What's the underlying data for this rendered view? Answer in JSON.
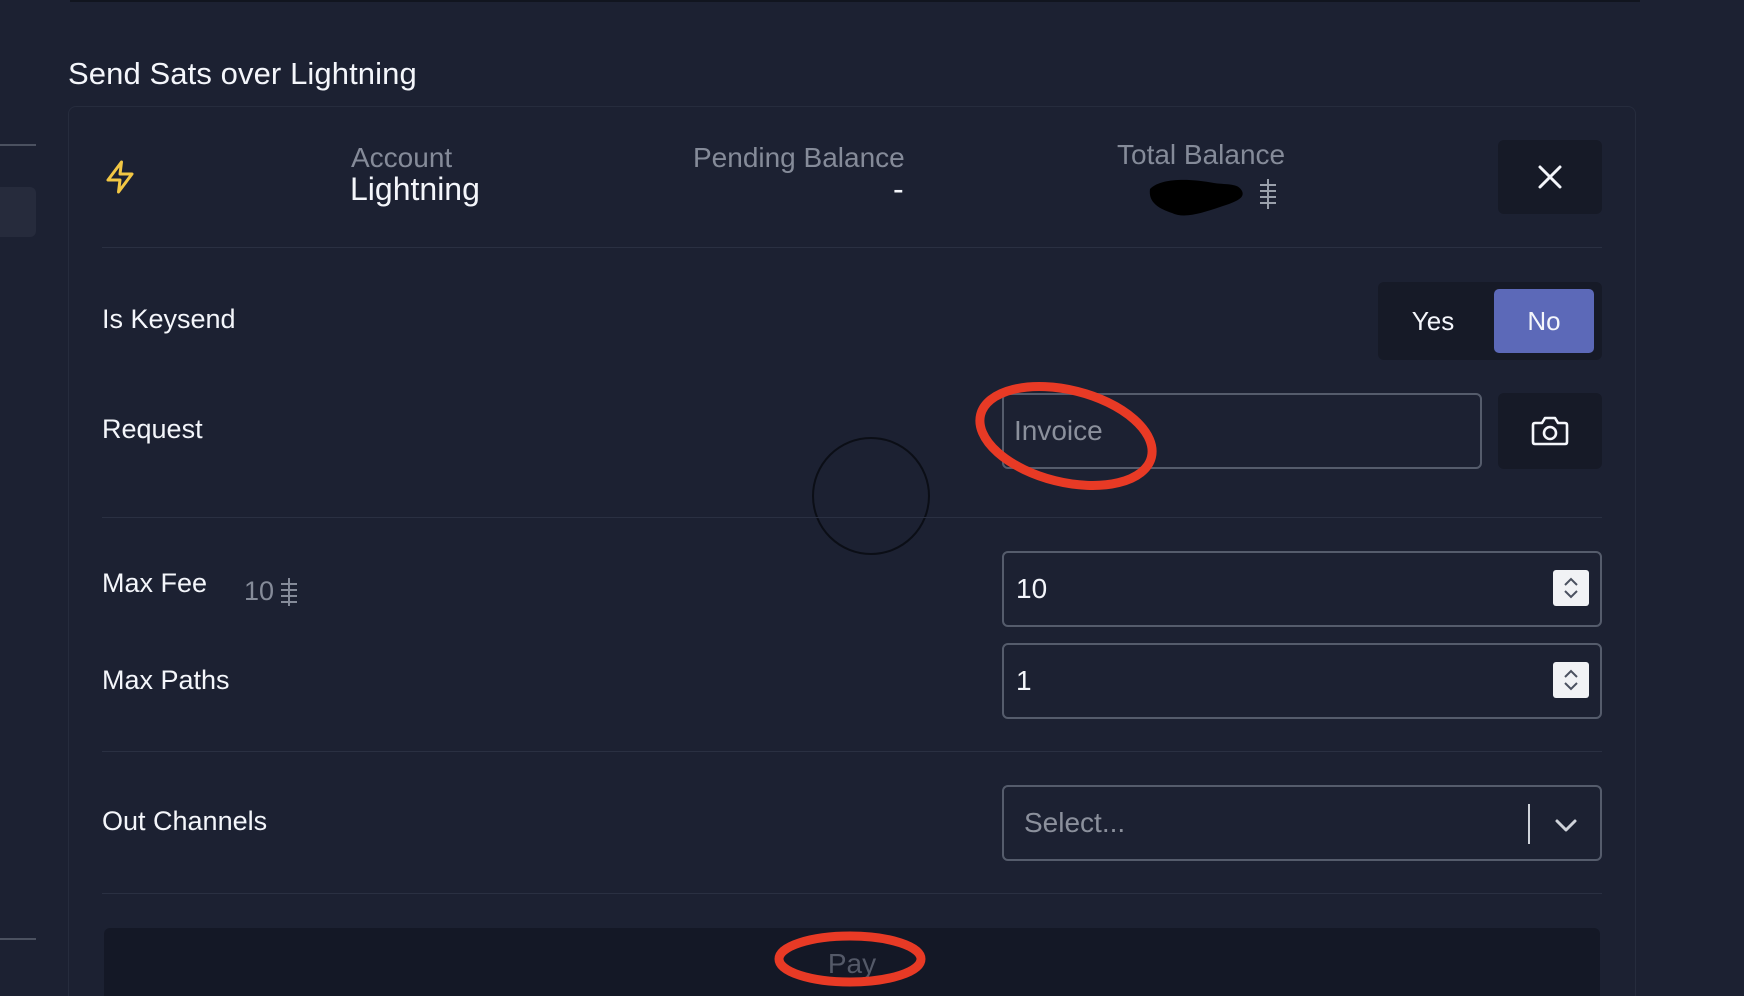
{
  "section": {
    "title": "Send Sats over Lightning"
  },
  "header": {
    "bolt_icon": "lightning-bolt-icon",
    "account_label": "Account",
    "account_value": "Lightning",
    "pending_label": "Pending Balance",
    "pending_value": "-",
    "total_label": "Total Balance",
    "total_value": "",
    "total_value_state": "redacted",
    "close_icon": "close-icon"
  },
  "keysend": {
    "label": "Is Keysend",
    "yes_label": "Yes",
    "no_label": "No",
    "selected": "No"
  },
  "request": {
    "label": "Request",
    "placeholder": "Invoice",
    "value": "",
    "camera_icon": "camera-icon"
  },
  "max_fee": {
    "label": "Max Fee",
    "hint": "10",
    "value": "10"
  },
  "max_paths": {
    "label": "Max Paths",
    "value": "1"
  },
  "out_channels": {
    "label": "Out Channels",
    "placeholder": "Select..."
  },
  "pay": {
    "label": "Pay"
  },
  "colors": {
    "background": "#1c2132",
    "accent": "#5c69b8",
    "bolt": "#f2c744",
    "annotation": "#e83a25"
  }
}
